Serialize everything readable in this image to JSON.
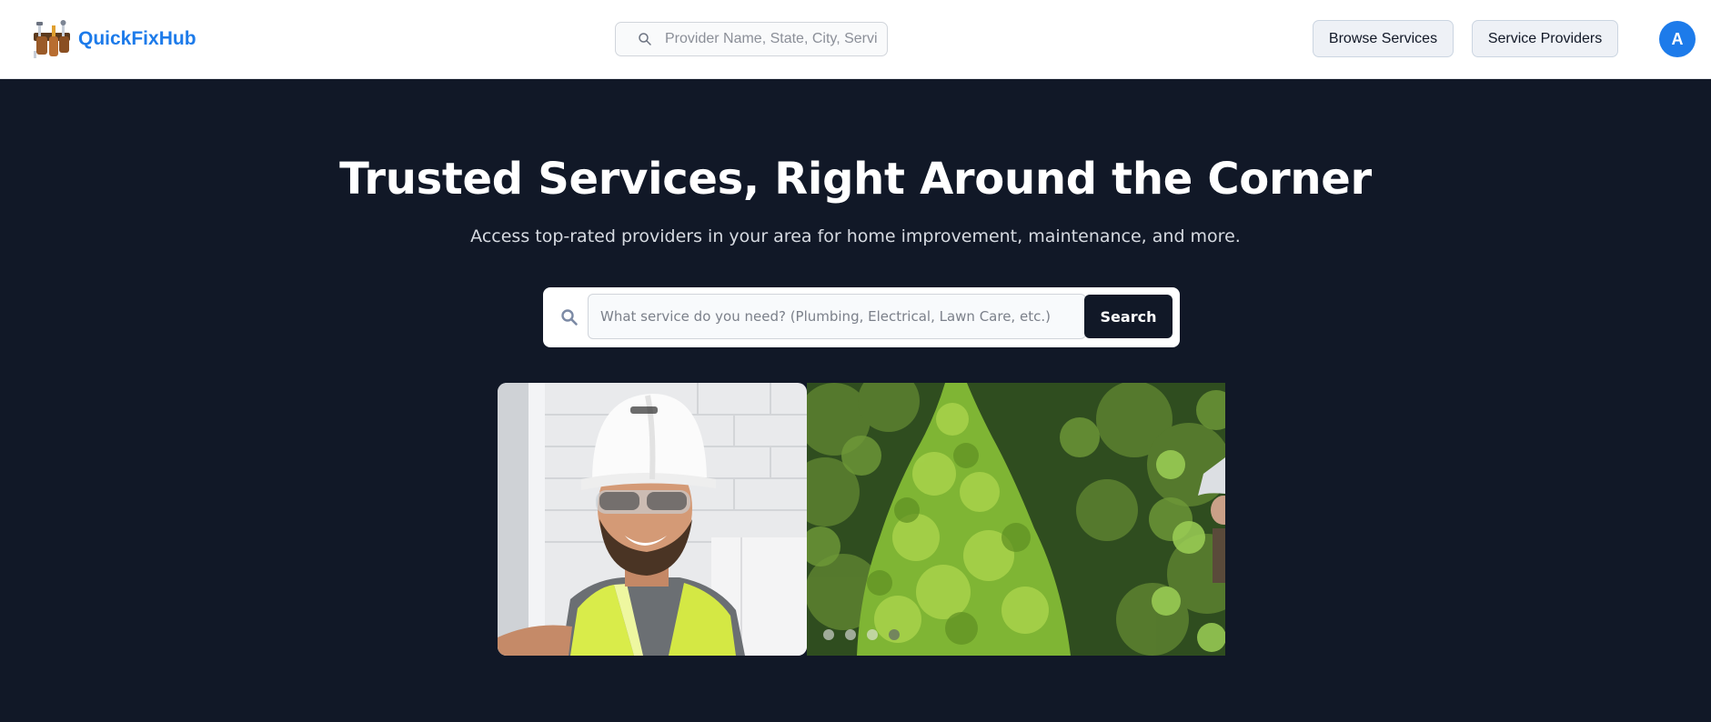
{
  "header": {
    "brand_name": "QuickFixHub",
    "search_placeholder": "Provider Name, State, City, Service",
    "browse_services_label": "Browse Services",
    "service_providers_label": "Service Providers",
    "avatar_initial": "A"
  },
  "hero": {
    "title": "Trusted Services, Right Around the Corner",
    "subtitle": "Access top-rated providers in your area for home improvement, maintenance, and more.",
    "search_placeholder": "What service do you need? (Plumbing, Electrical, Lawn Care, etc.)",
    "search_button_label": "Search"
  },
  "carousel": {
    "slide_count": 4,
    "active_slide_index": 3
  },
  "colors": {
    "brand": "#1d7bea",
    "hero_background": "#111827",
    "search_button": "#111827"
  },
  "icons": {
    "brand_logo": "toolbelt-logo-icon",
    "header_search": "search-icon",
    "hero_search": "search-icon"
  }
}
